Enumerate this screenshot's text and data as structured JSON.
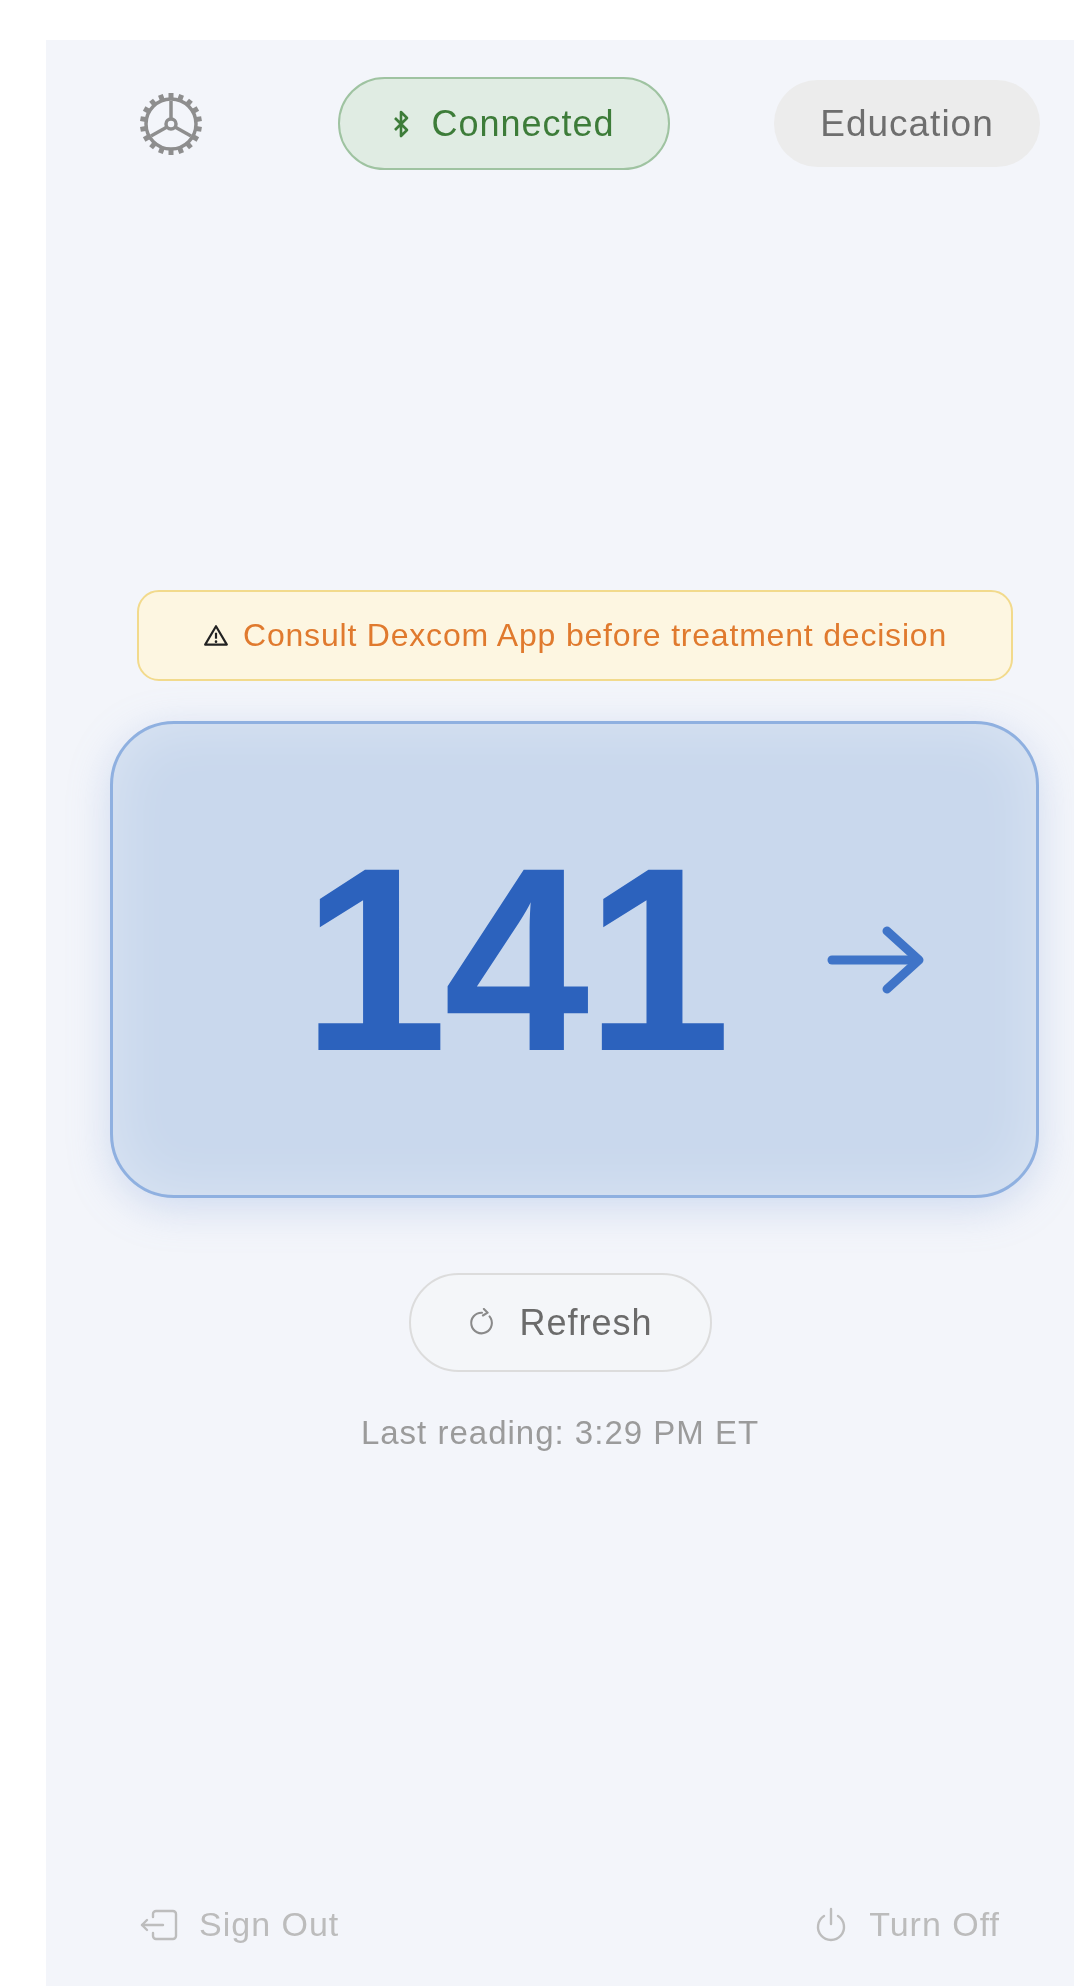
{
  "top_bar": {
    "connection": {
      "label": "Connected",
      "connected": true
    },
    "education_button": "Education"
  },
  "warning": "Consult Dexcom App before treatment decision",
  "reading": {
    "value": "141"
  },
  "refresh_button": "Refresh",
  "last_reading": "Last reading: 3:29 PM ET",
  "footer": {
    "sign_out": "Sign Out",
    "turn_off": "Turn Off"
  }
}
